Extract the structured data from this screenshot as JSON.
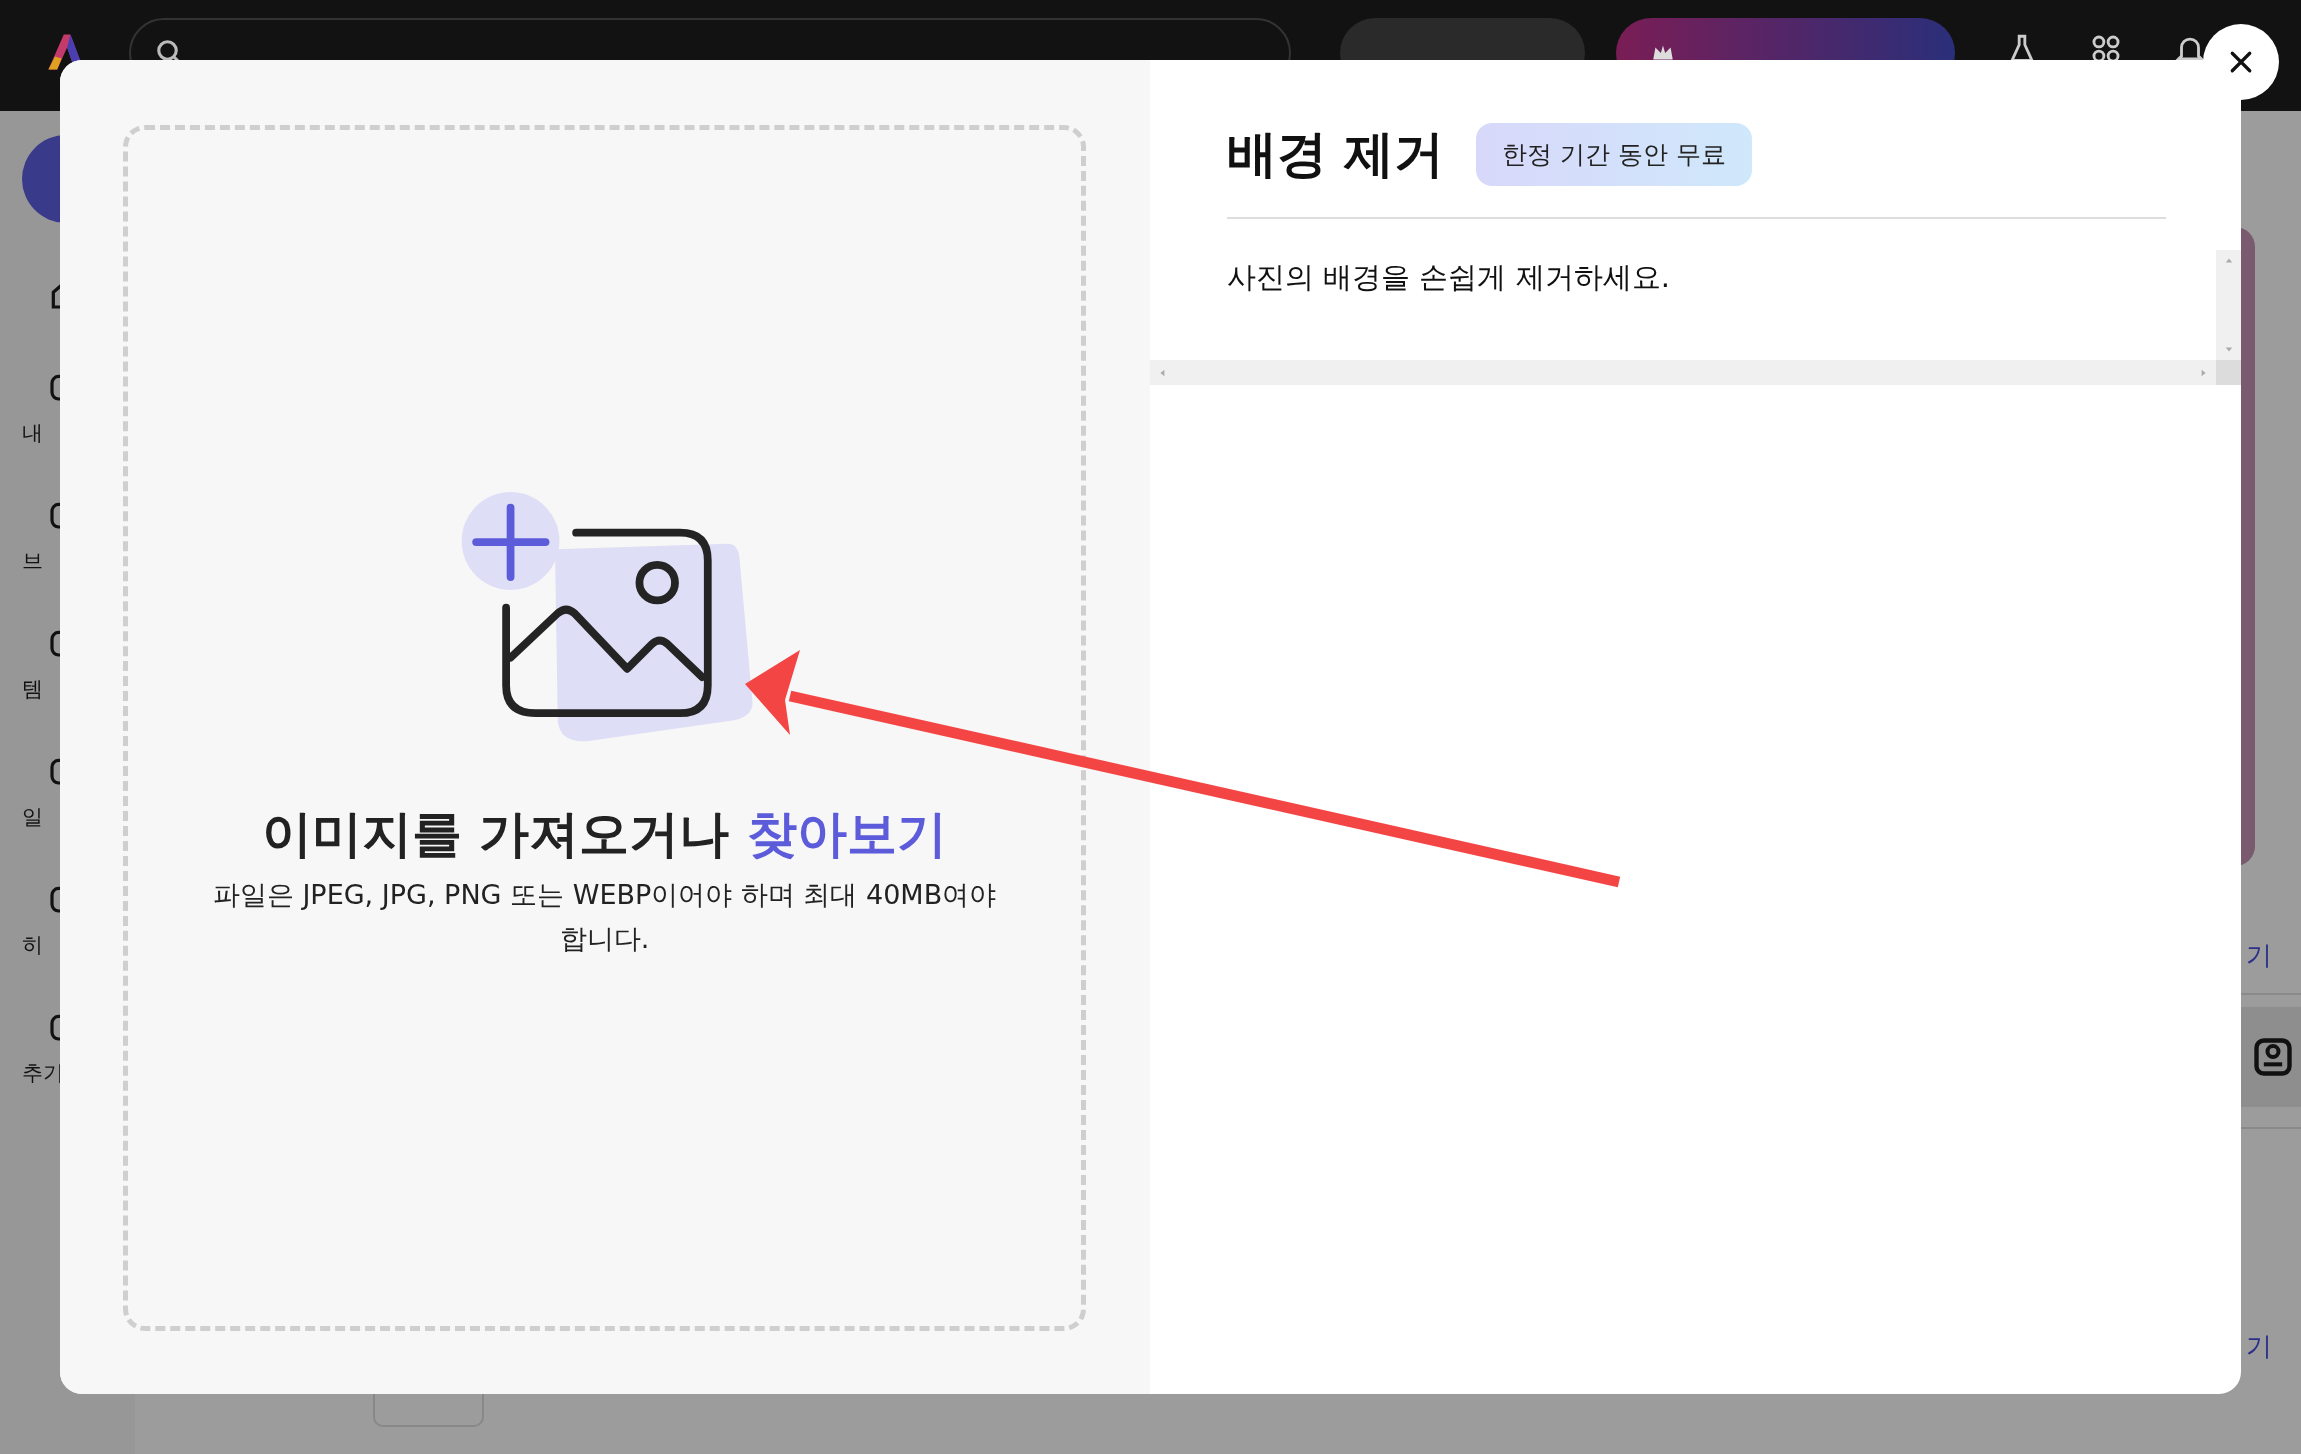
{
  "top_bar": {
    "buttons": [
      {
        "kind": "plain"
      },
      {
        "kind": "trial"
      }
    ]
  },
  "sidebar": {
    "items": [
      {
        "label": "내"
      },
      {
        "label": "브"
      },
      {
        "label": "템"
      },
      {
        "label": "일"
      },
      {
        "label": "히"
      },
      {
        "label": "추기"
      }
    ]
  },
  "right_edge": {
    "links": [
      "기",
      "기"
    ]
  },
  "dialog": {
    "upload": {
      "heading": "이미지를 가져오거나",
      "link": "찾아보기",
      "hint": "파일은 JPEG, JPG, PNG 또는 WEBP이어야 하며 최대 40MB여야 합니다."
    },
    "title": "배경 제거",
    "badge": "한정 기간 동안 무료",
    "description": "사진의 배경을 손쉽게 제거하세요."
  }
}
